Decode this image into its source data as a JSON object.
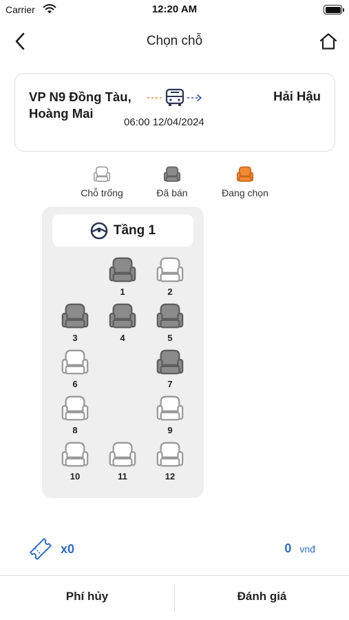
{
  "status_bar": {
    "carrier": "Carrier",
    "time": "12:20 AM"
  },
  "nav": {
    "title": "Chọn chỗ",
    "back_icon": "chevron-left-icon",
    "home_icon": "home-icon"
  },
  "trip": {
    "origin": "VP N9 Đồng Tàu, Hoàng Mai",
    "destination": "Hải Hậu",
    "departure": "06:00 12/04/2024",
    "route_icon": "bus-icon"
  },
  "legend": [
    {
      "label": "Chỗ trống",
      "status": "available"
    },
    {
      "label": "Đã bán",
      "status": "sold"
    },
    {
      "label": "Đang chọn",
      "status": "selecting"
    }
  ],
  "colors": {
    "available_fill": "#ffffff",
    "available_stroke": "#9a9a9a",
    "sold_fill": "#8b8b8b",
    "sold_stroke": "#5e5e5e",
    "selecting_fill": "#f08a33",
    "selecting_stroke": "#c9641a",
    "accent_blue": "#2b6bd6",
    "panel_bg": "#efefef"
  },
  "deck": {
    "label": "Tầng 1",
    "icon": "steering-wheel-icon"
  },
  "seats": [
    {
      "number": "1",
      "status": "sold"
    },
    {
      "number": "2",
      "status": "available"
    },
    {
      "number": "3",
      "status": "sold"
    },
    {
      "number": "4",
      "status": "sold"
    },
    {
      "number": "5",
      "status": "sold"
    },
    {
      "number": "6",
      "status": "available"
    },
    {
      "number": "7",
      "status": "sold"
    },
    {
      "number": "8",
      "status": "available"
    },
    {
      "number": "9",
      "status": "available"
    },
    {
      "number": "10",
      "status": "available"
    },
    {
      "number": "11",
      "status": "available"
    },
    {
      "number": "12",
      "status": "available"
    }
  ],
  "summary": {
    "ticket_icon": "ticket-icon",
    "ticket_count": "x0",
    "total_amount": "0",
    "currency": "vnđ"
  },
  "bottom_bar": {
    "cancel_fee_label": "Phí hủy",
    "review_label": "Đánh giá"
  }
}
